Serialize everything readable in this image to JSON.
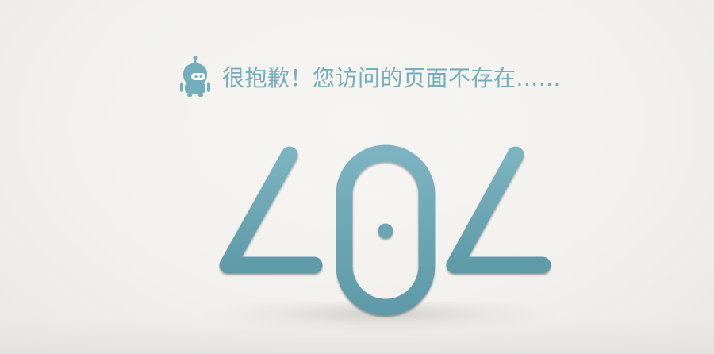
{
  "error": {
    "message": "很抱歉！您访问的页面不存在......",
    "code_digits": [
      "4",
      "0",
      "4"
    ],
    "icon": "robot-icon"
  },
  "colors": {
    "accent": "#74aebb",
    "digit_fill": "#6aa5b3",
    "background": "#f3f2ee"
  }
}
